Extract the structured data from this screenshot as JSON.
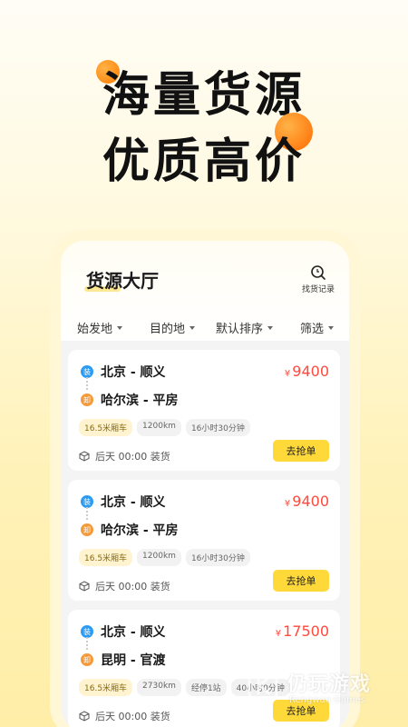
{
  "hero": {
    "line1": "海量货源",
    "line2": "优质高价"
  },
  "app": {
    "title": "货源大厅",
    "record_label": "找货记录",
    "filters": [
      "始发地",
      "目的地",
      "默认排序",
      "筛选"
    ]
  },
  "cards": [
    {
      "from_badge": "装",
      "from": "北京 - 顺义",
      "to_badge": "卸",
      "to": "哈尔滨 - 平房",
      "currency": "¥",
      "price": "9400",
      "tags": [
        "16.5米厢车",
        "1200km",
        "16小时30分钟"
      ],
      "time": "后天 00:00 装货",
      "action": "去抢单"
    },
    {
      "from_badge": "装",
      "from": "北京 - 顺义",
      "to_badge": "卸",
      "to": "哈尔滨 - 平房",
      "currency": "¥",
      "price": "9400",
      "tags": [
        "16.5米厢车",
        "1200km",
        "16小时30分钟"
      ],
      "time": "后天 00:00 装货",
      "action": "去抢单"
    },
    {
      "from_badge": "装",
      "from": "北京 - 顺义",
      "to_badge": "卸",
      "to": "昆明 - 官渡",
      "currency": "¥",
      "price": "17500",
      "tags": [
        "16.5米厢车",
        "2730km",
        "经停1站",
        "40小时0分钟"
      ],
      "time": "后天 00:00 装货",
      "action": "去抢单"
    }
  ],
  "watermark": {
    "name": "仍玩游戏",
    "en": "Rengwan Games"
  },
  "colors": {
    "accent": "#ffd93a",
    "price": "#ff4a3d",
    "load": "#2b9bf4",
    "unload": "#f59a3b"
  }
}
